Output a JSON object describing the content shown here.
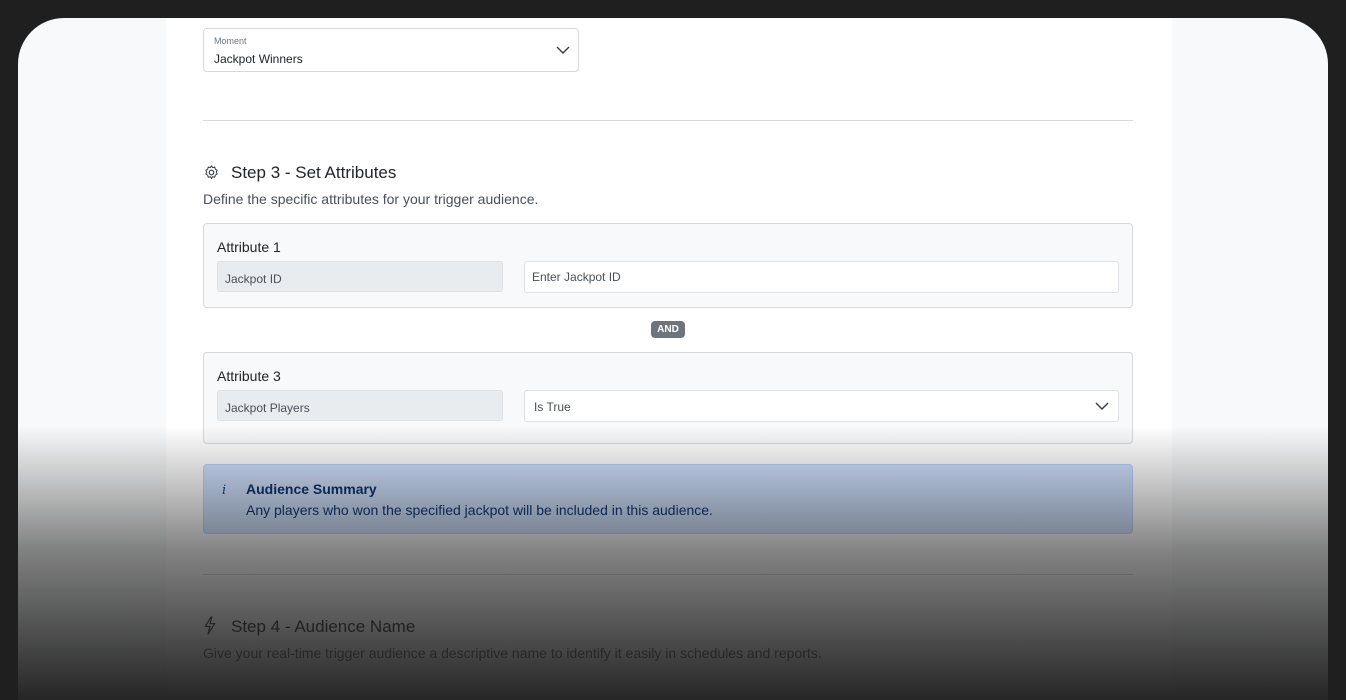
{
  "moment": {
    "label": "Moment",
    "value": "Jackpot Winners"
  },
  "step3": {
    "title": "Step 3 - Set Attributes",
    "description": "Define the specific attributes for your trigger audience.",
    "attributes": [
      {
        "title": "Attribute 1",
        "field": "Jackpot ID",
        "input_placeholder": "Enter Jackpot ID"
      },
      {
        "title": "Attribute 3",
        "field": "Jackpot Players",
        "operator": "Is True"
      }
    ],
    "connector": "AND"
  },
  "summary": {
    "icon": "info-icon",
    "icon_glyph": "i",
    "title": "Audience Summary",
    "text": "Any players who won the specified jackpot will be included in this audience."
  },
  "step4": {
    "title": "Step 4 - Audience Name",
    "description": "Give your real-time trigger audience a descriptive name to identify it easily in schedules and reports."
  }
}
